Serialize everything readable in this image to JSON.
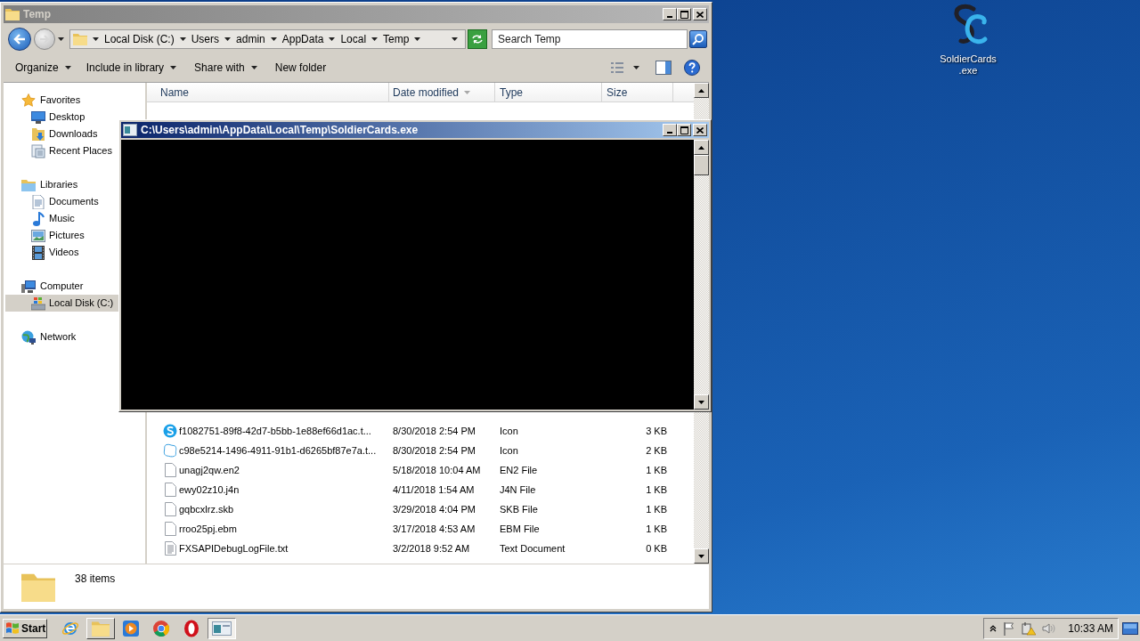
{
  "explorer": {
    "title": "Temp",
    "address": {
      "path": [
        "Local Disk (C:)",
        "Users",
        "admin",
        "AppData",
        "Local",
        "Temp"
      ]
    },
    "search": {
      "placeholder": "Search Temp"
    },
    "toolbar": [
      {
        "label": "Organize",
        "dropdown": true
      },
      {
        "label": "Include in library",
        "dropdown": true
      },
      {
        "label": "Share with",
        "dropdown": true
      },
      {
        "label": "New folder",
        "dropdown": false
      }
    ],
    "sidebar": [
      {
        "label": "Favorites",
        "kind": "star",
        "selected": false,
        "children": [
          {
            "label": "Desktop",
            "kind": "desktop",
            "selected": false
          },
          {
            "label": "Downloads",
            "kind": "downloads",
            "selected": false
          },
          {
            "label": "Recent Places",
            "kind": "recent",
            "selected": false
          }
        ]
      },
      {
        "label": "Libraries",
        "kind": "libraries",
        "selected": false,
        "children": [
          {
            "label": "Documents",
            "kind": "documents",
            "selected": false
          },
          {
            "label": "Music",
            "kind": "music",
            "selected": false
          },
          {
            "label": "Pictures",
            "kind": "pictures",
            "selected": false
          },
          {
            "label": "Videos",
            "kind": "videos",
            "selected": false
          }
        ]
      },
      {
        "label": "Computer",
        "kind": "computer",
        "selected": false,
        "children": [
          {
            "label": "Local Disk (C:)",
            "kind": "disk",
            "selected": true
          }
        ]
      },
      {
        "label": "Network",
        "kind": "network",
        "selected": false
      }
    ],
    "columns": [
      {
        "label": "Name",
        "sorted": false
      },
      {
        "label": "Date modified",
        "sorted": true
      },
      {
        "label": "Type",
        "sorted": false
      },
      {
        "label": "Size",
        "sorted": false
      }
    ],
    "rows": [
      {
        "kind": "badge",
        "name": "f1082751-89f8-42d7-b5bb-1e88ef66d1ac.t...",
        "date": "8/30/2018 2:54 PM",
        "type": "Icon",
        "size": "3 KB"
      },
      {
        "kind": "ring",
        "name": "c98e5214-1496-4911-91b1-d6265bf87e7a.t...",
        "date": "8/30/2018 2:54 PM",
        "type": "Icon",
        "size": "2 KB"
      },
      {
        "kind": "blank",
        "name": "unagj2qw.en2",
        "date": "5/18/2018 10:04 AM",
        "type": "EN2 File",
        "size": "1 KB"
      },
      {
        "kind": "blank",
        "name": "ewy02z10.j4n",
        "date": "4/11/2018 1:54 AM",
        "type": "J4N File",
        "size": "1 KB"
      },
      {
        "kind": "blank",
        "name": "gqbcxlrz.skb",
        "date": "3/29/2018 4:04 PM",
        "type": "SKB File",
        "size": "1 KB"
      },
      {
        "kind": "blank",
        "name": "rroo25pj.ebm",
        "date": "3/17/2018 4:53 AM",
        "type": "EBM File",
        "size": "1 KB"
      },
      {
        "kind": "text",
        "name": "FXSAPIDebugLogFile.txt",
        "date": "3/2/2018 9:52 AM",
        "type": "Text Document",
        "size": "0 KB"
      }
    ],
    "status": "38 items"
  },
  "console": {
    "title": "C:\\Users\\admin\\AppData\\Local\\Temp\\SoldierCards.exe"
  },
  "desktop_icons": [
    {
      "label_lines": [
        "SoldierCards",
        ".exe"
      ]
    }
  ],
  "taskbar": {
    "start": "Start",
    "items": [
      {
        "kind": "browser",
        "open": false,
        "active": false
      },
      {
        "kind": "folder",
        "open": true,
        "active": false
      },
      {
        "kind": "media",
        "open": false,
        "active": false
      },
      {
        "kind": "round-browser",
        "open": false,
        "active": false
      },
      {
        "kind": "o-ring",
        "open": false,
        "active": false
      },
      {
        "kind": "window",
        "open": true,
        "active": true
      }
    ],
    "clock": "10:33 AM"
  }
}
